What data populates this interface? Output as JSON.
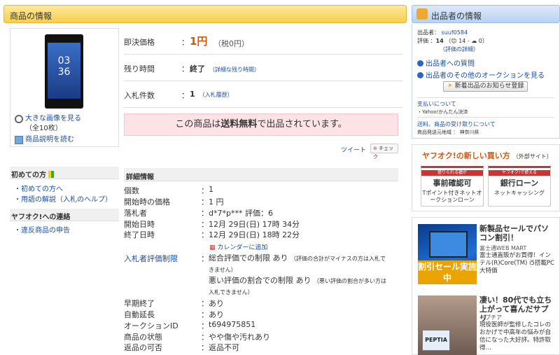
{
  "main_header": {
    "title": "商品の情報"
  },
  "image_box": {
    "clock_hour": "03",
    "clock_min": "36",
    "view_large": "大きな画像を見る",
    "view_count": "（全10枚）",
    "read_desc": "商品説明を読む"
  },
  "price": {
    "buyout_label": "即決価格",
    "buyout_value": "1円",
    "buyout_tax": "（税0円）",
    "remaining_label": "残り時間",
    "remaining_value": "終了",
    "remaining_link": "（詳細な残り時間）",
    "bids_label": "入札件数",
    "bids_value": "1",
    "bids_link": "（入札履歴）"
  },
  "free_ship": {
    "pre": "この商品は",
    "bold": "送料無料",
    "post": "で出品されています。"
  },
  "share": {
    "tweet": "ツイート",
    "check": "チェック"
  },
  "left_nav": {
    "beginner_title": "初めての方",
    "beginner_items": [
      "初めての方へ",
      "用語の解説（入札のヘルプ）"
    ],
    "contact_title": "ヤフオク!への連絡",
    "contact_items": [
      "違反商品の申告"
    ]
  },
  "details": {
    "header": "詳細情報",
    "rows": [
      {
        "label": "個数",
        "value": "1"
      },
      {
        "label": "開始時の価格",
        "value": "1 円"
      },
      {
        "label": "落札者",
        "value": "d*7*p*** 評価：6"
      },
      {
        "label": "開始日時",
        "value": "12月 29日(日) 17時 34分"
      },
      {
        "label": "終了日時",
        "value": "12月 29日(日) 18時 22分"
      }
    ],
    "calendar_link": "カレンダーに追加",
    "bid_limit_label": "入札者評価制限",
    "bid_limit_1": "総合評価での制限 あり",
    "bid_limit_1_note_a": "（評価の合計がマイナスの方は入札で",
    "bid_limit_1_note_b": "きません）",
    "bid_limit_2": "悪い評価の割合での制限 あり",
    "bid_limit_2_note_a": "（悪い評価の割合が多い方は",
    "bid_limit_2_note_b": "入札できません）",
    "rows2": [
      {
        "label": "早期終了",
        "value": "あり"
      },
      {
        "label": "自動延長",
        "value": "あり"
      },
      {
        "label": "オークションID",
        "value": "t694975851"
      },
      {
        "label": "商品の状態",
        "value": "やや傷や汚れあり"
      },
      {
        "label": "返品の可否",
        "value": "返品不可"
      }
    ]
  },
  "seller": {
    "header": "出品者の情報",
    "id_label": "出品者：",
    "id_value": "suuf0584",
    "rating_label": "評価",
    "rating_value": "14",
    "rating_detail": "（😊 14 - ☁ 0）",
    "rating_link": "（評価の詳細）",
    "question_link": "出品者への質問",
    "other_link": "出品者のその他のオークションを見る",
    "notify_btn": "新着出品のお知らせ登録",
    "pay_link": "支払いについて",
    "pay_item": "・Yahoo!かんたん決済",
    "ship_link": "送料、商品の受け取りについて",
    "ship_origin": "商品発送元地域 ： 神奈川県"
  },
  "new_buy": {
    "title": "ヤフオク!の新しい買い方",
    "subtitle": "（外部サイト）",
    "card1_top": "借りられる額が",
    "card1_big": "事前確認可",
    "card1_desc": "Tポイント付きネットオークションローン",
    "card2_top": "ヤフオク!で使える",
    "card2_big": "銀行ローン",
    "card2_desc": "ネットキャッシング"
  },
  "ads": [
    {
      "title": "新製品セールでパソコン割引！",
      "source": "富士通WEB MART",
      "desc": "富士通直販がお買得！インテル(R)Core(TM) i5搭載PC大特価",
      "img_text": "割引セール実施中"
    },
    {
      "title": "凄い！80代でも立ち上がって喜んだサプリ",
      "source": "ペプチア",
      "desc": "現役医師が監修したコレのおかげで中高年の悩みが自信になった大好評。特許取得…",
      "img_text": "PEPTIA"
    }
  ]
}
